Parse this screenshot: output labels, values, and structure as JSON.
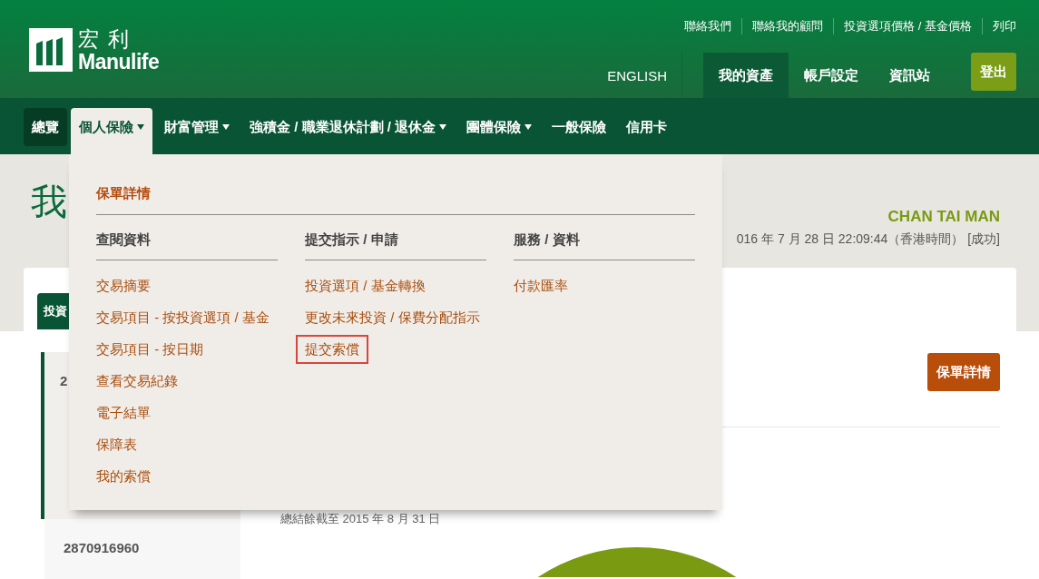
{
  "header": {
    "logo": {
      "chinese": "宏 利",
      "english": "Manulife"
    },
    "utility_links": [
      "聯絡我們",
      "聯絡我的顧問",
      "投資選項價格 / 基金價格",
      "列印"
    ],
    "language_link": "ENGLISH",
    "tabs": [
      {
        "label": "我的資產",
        "selected": true
      },
      {
        "label": "帳戶設定",
        "selected": false
      },
      {
        "label": "資訊站",
        "selected": false
      }
    ],
    "logout_button": "登出"
  },
  "nav": [
    {
      "label": "總覽",
      "selected": true,
      "expanded": false,
      "has_menu": false
    },
    {
      "label": "個人保險",
      "selected": false,
      "expanded": true,
      "has_menu": true
    },
    {
      "label": "財富管理",
      "selected": false,
      "expanded": false,
      "has_menu": true
    },
    {
      "label": "強積金 / 職業退休計劃 / 退休金",
      "selected": false,
      "expanded": false,
      "has_menu": true
    },
    {
      "label": "團體保險",
      "selected": false,
      "expanded": false,
      "has_menu": true
    },
    {
      "label": "一般保險",
      "selected": false,
      "expanded": false,
      "has_menu": false
    },
    {
      "label": "信用卡",
      "selected": false,
      "expanded": false,
      "has_menu": false
    }
  ],
  "dropdown": {
    "title": "保單詳情",
    "columns": [
      {
        "heading": "查閱資料",
        "links": [
          {
            "label": "交易摘要",
            "highlighted": false
          },
          {
            "label": "交易項目 - 按投資選項 / 基金",
            "highlighted": false
          },
          {
            "label": "交易項目 - 按日期",
            "highlighted": false
          },
          {
            "label": "查看交易紀錄",
            "highlighted": false
          },
          {
            "label": "電子結單",
            "highlighted": false
          },
          {
            "label": "保障表",
            "highlighted": false
          },
          {
            "label": "我的索償",
            "highlighted": false
          }
        ]
      },
      {
        "heading": "提交指示 / 申請",
        "links": [
          {
            "label": "投資選項 / 基金轉換",
            "highlighted": false
          },
          {
            "label": "更改未來投資 / 保費分配指示",
            "highlighted": false
          },
          {
            "label": "提交索償",
            "highlighted": true
          }
        ]
      },
      {
        "heading": "服務 / 資料",
        "links": [
          {
            "label": "付款匯率",
            "highlighted": false
          }
        ]
      }
    ]
  },
  "page": {
    "title": "我",
    "user_name": "CHAN TAI MAN",
    "last_login": "016 年 7 月 28 日 22:09:44（香港時間） [成功]"
  },
  "card": {
    "tab": {
      "label": "投資",
      "selected": true
    },
    "sidebar": [
      {
        "label": "2",
        "selected": true
      },
      {
        "label": "2870916960",
        "selected": false
      }
    ],
    "policy_button": "保單詳情",
    "balance_note": "總結餘截至 2015 年 8 月 31 日"
  }
}
